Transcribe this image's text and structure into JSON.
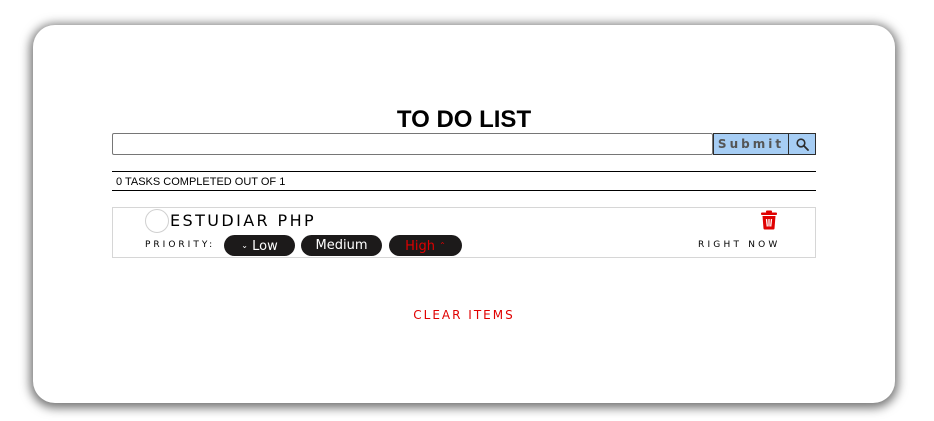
{
  "app": {
    "title": "TO DO LIST"
  },
  "form": {
    "input_value": "",
    "input_placeholder": "",
    "submit_label": "Submit",
    "search_icon": "search-icon"
  },
  "counter": {
    "text": "0 TASKS COMPLETED OUT OF 1"
  },
  "tasks": [
    {
      "name": "ESTUDIAR PHP",
      "completed": false,
      "priority_label": "PRIORITY:",
      "priorities": [
        {
          "label": "Low",
          "arrow": "⌄"
        },
        {
          "label": "Medium"
        },
        {
          "label": "High",
          "arrow": "⌃"
        }
      ],
      "selected_priority": "High",
      "time": "RIGHT NOW",
      "delete_icon": "trash-icon"
    }
  ],
  "footer": {
    "clear_label": "CLEAR ITEMS"
  },
  "colors": {
    "accent_red": "#e00000",
    "button_blue": "#a6cdf4",
    "pill_dark": "#1c1a1a"
  }
}
